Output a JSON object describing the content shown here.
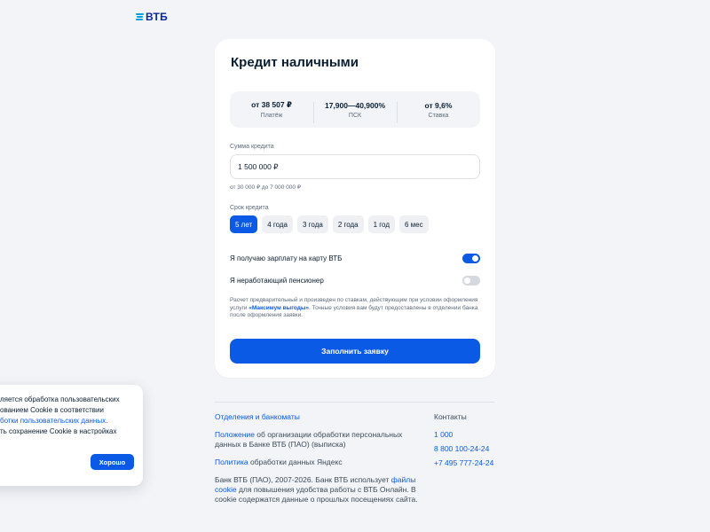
{
  "brand": {
    "name": "ВТБ",
    "colors": {
      "accent": "#0a5ae6",
      "logo": "#0a2896",
      "logo_mark": "#009fdf"
    }
  },
  "card": {
    "title": "Кредит наличными",
    "stats": [
      {
        "value": "от 38 507 ₽",
        "label": "Платёж"
      },
      {
        "value": "17,900—40,900%",
        "label": "ПСК"
      },
      {
        "value": "от 9,6%",
        "label": "Ставка"
      }
    ],
    "amount": {
      "label": "Сумма кредита",
      "value": "1 500 000 ₽",
      "hint": "от 30 000 ₽ до 7 000 000 ₽"
    },
    "term": {
      "label": "Срок кредита",
      "options": [
        "5 лет",
        "4 года",
        "3 года",
        "2 года",
        "1 год",
        "6 мес"
      ],
      "selected": "5 лет"
    },
    "toggles": [
      {
        "label": "Я получаю зарплату на карту ВТБ",
        "state": "on"
      },
      {
        "label": "Я неработающий пенсионер",
        "state": "off"
      }
    ],
    "disclaimer": {
      "part1": "Расчет предварительный и произведен по ставкам, действующим при условии оформления услуги ",
      "link": "«Максимум выгоды»",
      "part2": ". Точные условия вам будут предоставлены в отделении банка после оформления заявки."
    },
    "submit_label": "Заполнить заявку"
  },
  "footer": {
    "branches_link": "Отделения и банкоматы",
    "regulation": {
      "link": "Положение",
      "text": " об организации обработки персональных данных в Банке ВТБ (ПАО) (выписка)"
    },
    "policy": {
      "link": "Политика",
      "text": " обработки данных Яндекс"
    },
    "copyright": {
      "part1": "Банк ВТБ (ПАО), 2007-2026. Банк ВТБ использует ",
      "link": "файлы cookie",
      "part2": "  для повышения удобства работы с ВТБ Онлайн. В cookie содержатся данные о прошлых посещениях сайта."
    },
    "contacts_title": "Контакты",
    "contacts": [
      "1 000",
      "8 800 100-24-24",
      "+7 495 777-24-24"
    ]
  },
  "cookie_banner": {
    "line1": "ляется обработка пользовательских",
    "line2": "ованием Cookie в соответствии",
    "line3_link": "ботки пользовательских данных",
    "line3_tail": ".",
    "line4": "ть сохранение Cookie в настройках",
    "button_label": "Хорошо"
  }
}
